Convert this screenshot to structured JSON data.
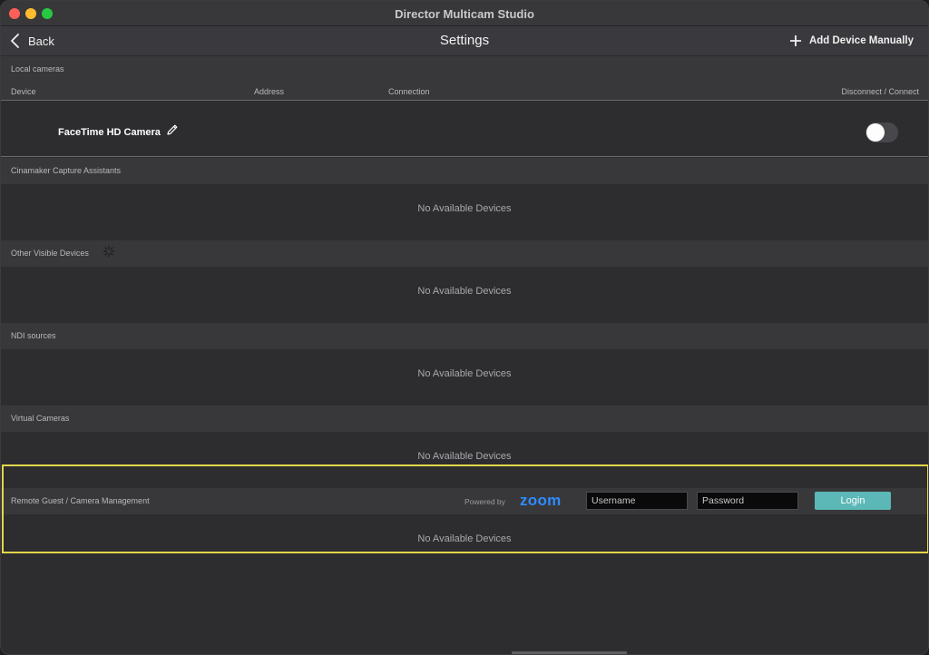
{
  "window": {
    "title": "Director Multicam Studio"
  },
  "toolbar": {
    "back_label": "Back",
    "page_title": "Settings",
    "add_label": "Add Device Manually"
  },
  "local_cameras": {
    "title": "Local cameras",
    "columns": {
      "device": "Device",
      "address": "Address",
      "connection": "Connection",
      "action": "Disconnect / Connect"
    },
    "devices": [
      {
        "name": "FaceTime HD Camera",
        "connected": false
      }
    ]
  },
  "sections": {
    "capture_assistants": {
      "title": "Cinamaker Capture Assistants",
      "empty": "No Available Devices"
    },
    "other_visible": {
      "title": "Other Visible Devices",
      "empty": "No Available Devices"
    },
    "ndi": {
      "title": "NDI sources",
      "empty": "No Available Devices"
    },
    "virtual": {
      "title": "Virtual Cameras",
      "empty": "No Available Devices"
    },
    "remote_guest": {
      "title": "Remote Guest / Camera Management",
      "powered_by": "Powered by",
      "brand": "zoom",
      "username_placeholder": "Username",
      "password_placeholder": "Password",
      "login_label": "Login",
      "empty": "No Available Devices"
    }
  },
  "colors": {
    "accent": "#5bb8b6",
    "zoom_brand": "#2d8cff",
    "highlight": "#e3d64a"
  }
}
